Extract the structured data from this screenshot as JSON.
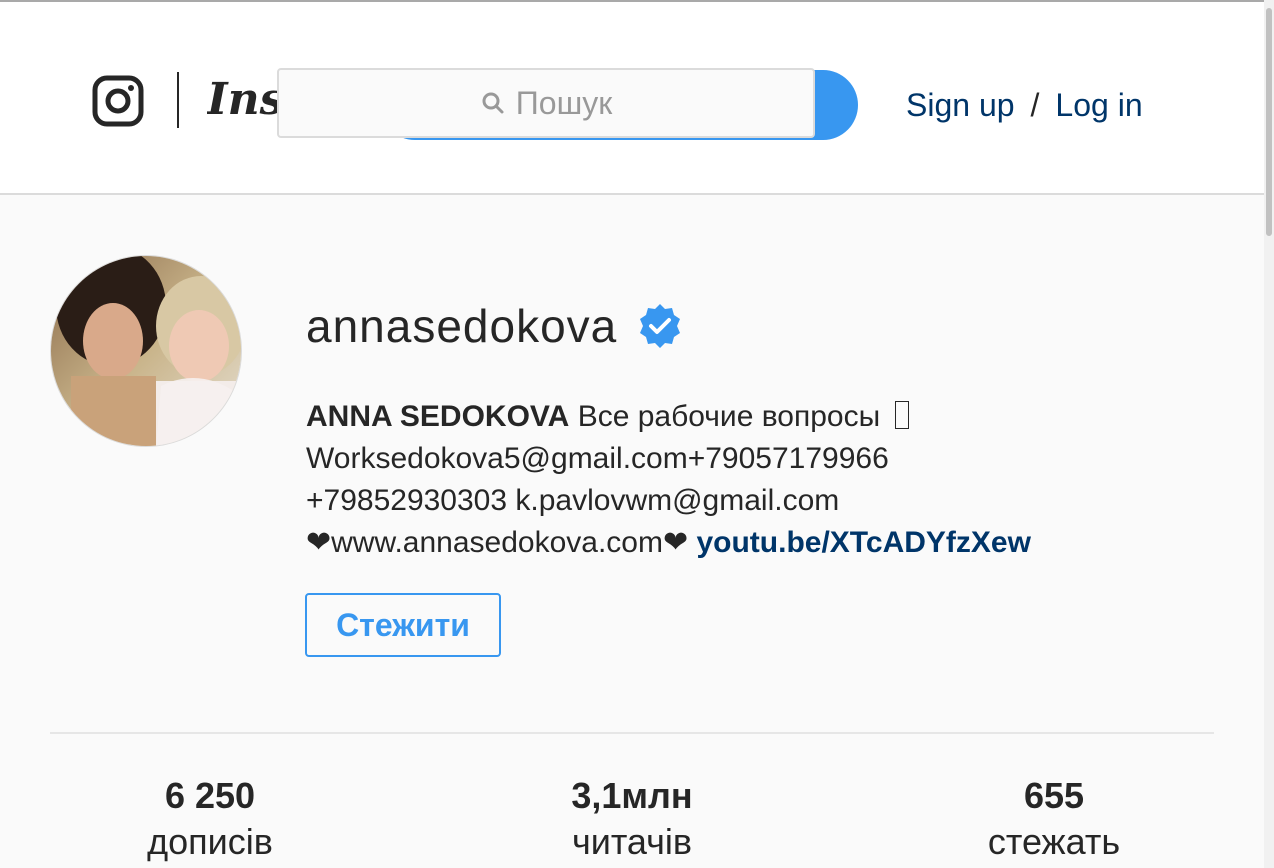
{
  "header": {
    "logo_word": "Instagram",
    "search": {
      "placeholder": "Пошук"
    },
    "signup_label": "Sign up",
    "separator": "/",
    "login_label": "Log in"
  },
  "profile": {
    "username": "annasedokova",
    "verified": true,
    "bio": {
      "full_name": "ANNA SEDOKOVA",
      "line1_rest": " Все рабочие вопросы ",
      "line2": "Worksedokova5@gmail.com+79057179966",
      "line3": "+79852930303 k.pavlovwm@gmail.com",
      "line4_text": "❤www.annasedokova.com❤ ",
      "link": "youtu.be/XTcADYfzXew"
    },
    "follow_label": "Стежити"
  },
  "stats": [
    {
      "value": "6 250",
      "label": "дописів"
    },
    {
      "value": "3,1млн",
      "label": "читачів"
    },
    {
      "value": "655",
      "label": "стежать"
    }
  ],
  "colors": {
    "accent": "#3897f0",
    "link": "#003569",
    "text": "#262626",
    "background": "#fafafa"
  },
  "icons": {
    "logo": "instagram-camera-icon",
    "search": "search-icon",
    "verified": "verified-badge-icon"
  }
}
